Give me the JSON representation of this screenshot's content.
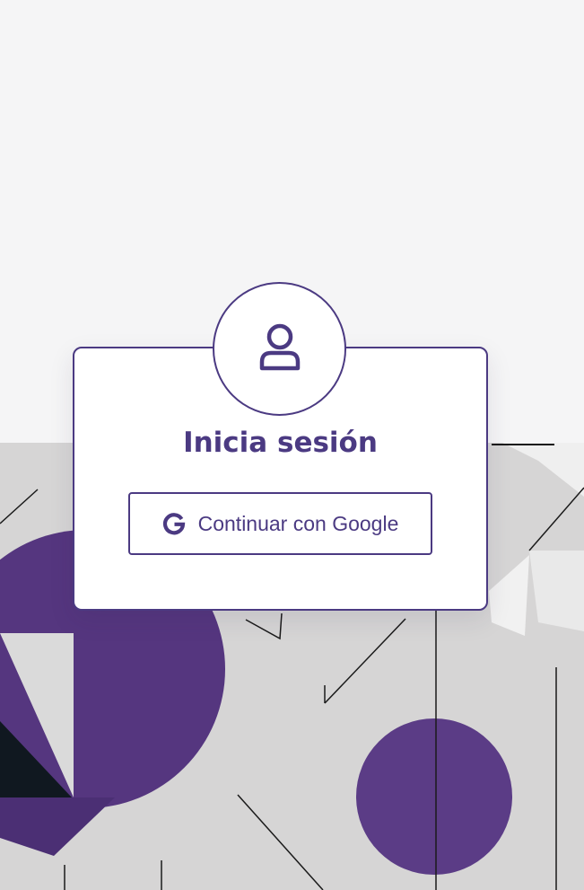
{
  "login": {
    "title": "Inicia sesión",
    "google_button_label": "Continuar con Google"
  },
  "icons": {
    "avatar": "user-icon",
    "google": "google-g-icon"
  },
  "colors": {
    "accent": "#4b3a82",
    "page_background": "#f5f5f6",
    "card_background": "#ffffff",
    "art_background": "#d6d5d5",
    "art_purple": "#5a3a84"
  }
}
